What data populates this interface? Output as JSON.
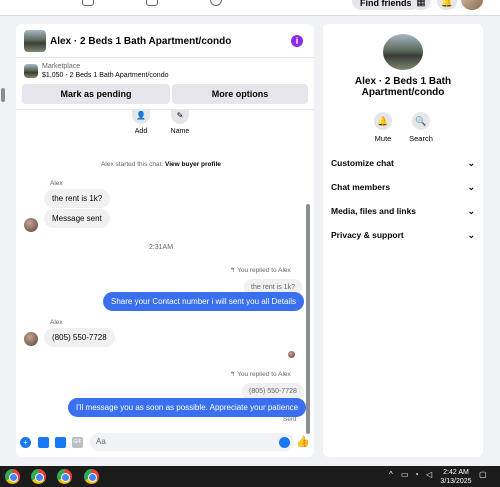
{
  "topbar": {
    "find_friends": "Find friends"
  },
  "chat": {
    "title": "Alex · 2 Beds 1 Bath Apartment/condo",
    "info_glyph": "i",
    "marketplace": {
      "label": "Marketplace",
      "item": "$1,050 - 2 Beds 1 Bath Apartment/condo",
      "mark_pending": "Mark as pending",
      "more_options": "More options"
    },
    "actions": [
      {
        "label": "Add",
        "icon": "add-person-icon"
      },
      {
        "label": "Name",
        "icon": "pencil-icon"
      }
    ],
    "started_text": "Alex started this chat.",
    "view_profile": "View buyer profile",
    "sender_name": "Alex",
    "messages_1": [
      "the rent is 1k?",
      "Message sent"
    ],
    "timestamp": "2:31AM",
    "reply_note_1": "You replied to Alex",
    "quote_1": "the rent is 1k?",
    "out_1": "Share your Contact number i will sent you all Details",
    "sender_name_2": "Alex",
    "in_phone": "(805) 550-7728",
    "reply_note_2": "You replied to Alex",
    "quote_2": "(805) 550-7728",
    "out_2": "I'll message you as soon as possible. Appreciate your patience",
    "sent_status": "Sent",
    "composer_placeholder": "Aa"
  },
  "details": {
    "title": "Alex · 2 Beds 1 Bath Apartment/condo",
    "mute": "Mute",
    "search": "Search",
    "sections": [
      "Customize chat",
      "Chat members",
      "Media, files and links",
      "Privacy & support"
    ]
  },
  "taskbar": {
    "time": "2:42 AM",
    "date": "3/13/2025"
  },
  "colors": {
    "accent": "#3a6ff0",
    "info_purple": "#8b2be2"
  }
}
